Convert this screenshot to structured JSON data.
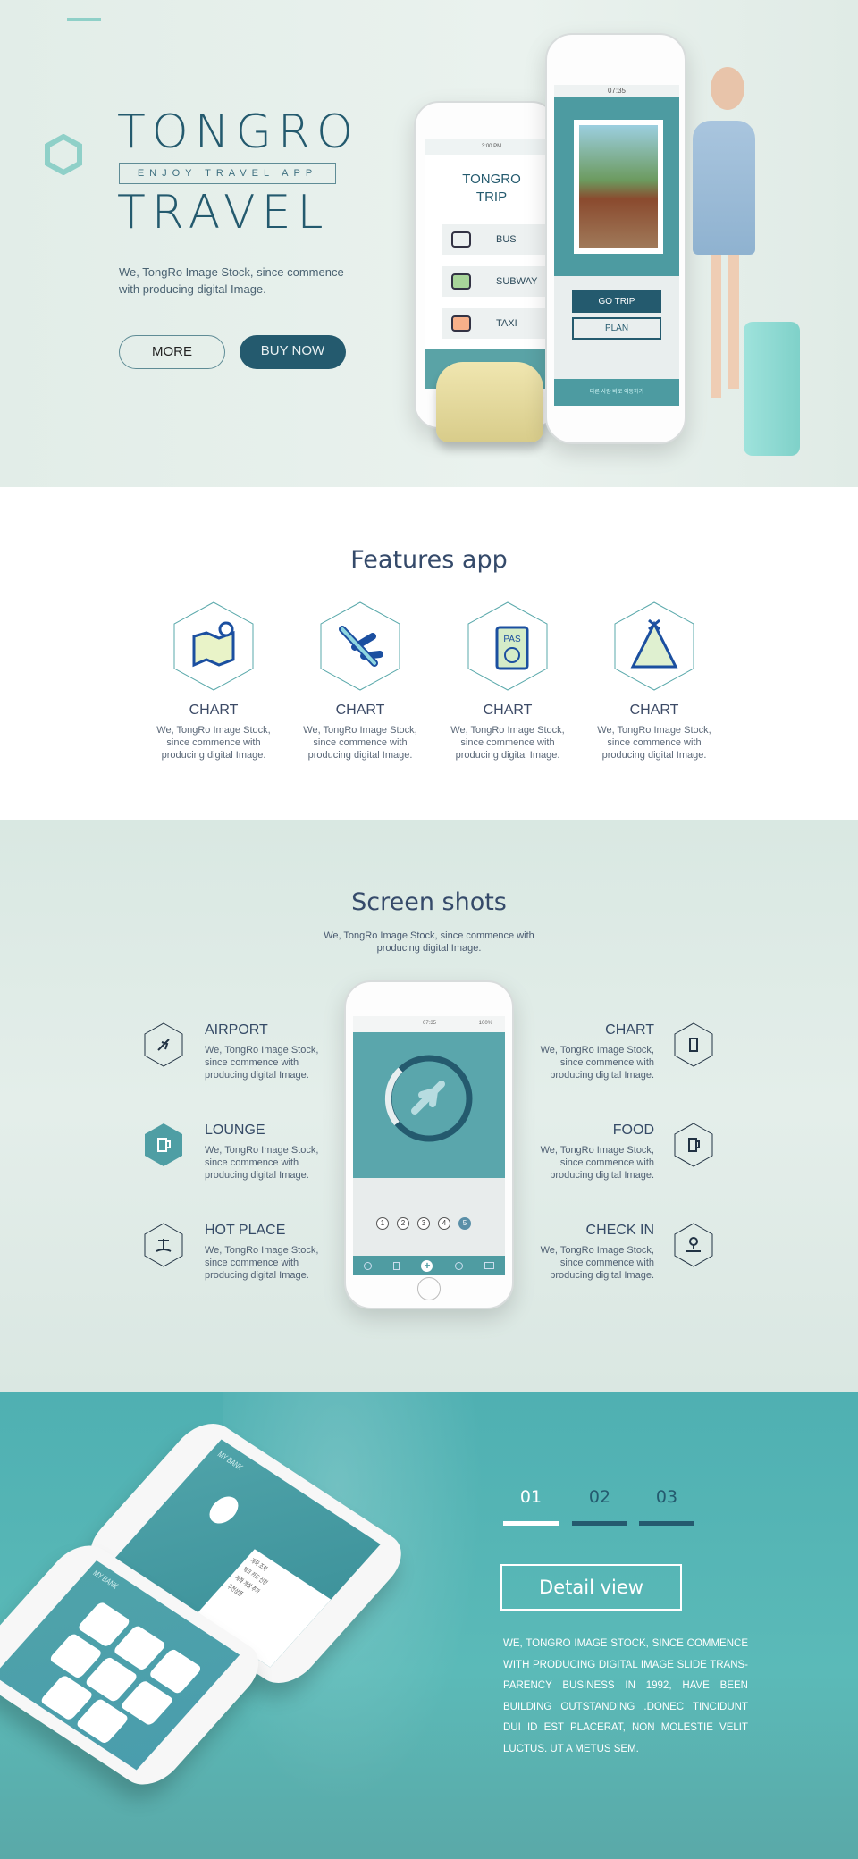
{
  "hero": {
    "title_top": "TONGRO",
    "tagline": "ENJOY TRAVEL APP",
    "title_bottom": "TRAVEL",
    "description": "We, TongRo Image Stock, since commence with producing digital Image.",
    "more_label": "MORE",
    "buy_label": "BUY NOW",
    "phone_left": {
      "status_time": "3:00 PM",
      "app_title_1": "TONGRO",
      "app_title_2": "TRIP",
      "options": [
        {
          "label": "BUS",
          "icon": "bus-icon"
        },
        {
          "label": "SUBWAY",
          "icon": "subway-icon"
        },
        {
          "label": "TAXI",
          "icon": "taxi-icon"
        }
      ]
    },
    "phone_right": {
      "status_time": "07:35",
      "go_trip": "GO TRIP",
      "plan": "PLAN",
      "footer_text": "다른 사람 바로 이동하기"
    }
  },
  "features": {
    "title": "Features app",
    "items": [
      {
        "title": "CHART",
        "description": "We, TongRo Image Stock, since commence with producing digital Image.",
        "icon": "map-icon"
      },
      {
        "title": "CHART",
        "description": "We, TongRo Image Stock, since commence with producing digital Image.",
        "icon": "airplane-icon"
      },
      {
        "title": "CHART",
        "description": "We, TongRo Image Stock, since commence with producing digital Image.",
        "icon": "passport-icon",
        "icon_text": "PAS"
      },
      {
        "title": "CHART",
        "description": "We, TongRo Image Stock, since commence with producing digital Image.",
        "icon": "tent-icon"
      }
    ]
  },
  "screenshots": {
    "title": "Screen shots",
    "subtitle": "We, TongRo Image Stock, since commence with producing digital Image.",
    "left": [
      {
        "title": "AIRPORT",
        "description": "We, TongRo Image Stock, since commence with producing digital Image.",
        "icon": "airplane-icon"
      },
      {
        "title": "LOUNGE",
        "description": "We, TongRo Image Stock, since commence with producing digital Image.",
        "icon": "beer-icon",
        "active": true
      },
      {
        "title": "HOT PLACE",
        "description": "We, TongRo Image Stock, since commence with producing digital Image.",
        "icon": "palm-island-icon"
      }
    ],
    "right": [
      {
        "title": "CHART",
        "description": "We, TongRo Image Stock, since commence with producing digital Image.",
        "icon": "luggage-icon"
      },
      {
        "title": "FOOD",
        "description": "We, TongRo Image Stock, since commence with producing digital Image.",
        "icon": "beer-icon"
      },
      {
        "title": "CHECK IN",
        "description": "We, TongRo Image Stock, since commence with producing digital Image.",
        "icon": "location-pin-icon"
      }
    ],
    "phone": {
      "status_time": "07:35",
      "battery": "100%",
      "steps": [
        "1",
        "2",
        "3",
        "4",
        "5"
      ],
      "active_step": 5
    }
  },
  "detail": {
    "tabs": [
      "01",
      "02",
      "03"
    ],
    "active_tab": 0,
    "button_label": "Detail view",
    "paragraph": "We, TongRo Image Stock, since commence with producing digital Image slide trans-parency business in 1992, have been building outstanding .Donec tincidunt dui id est placerat, non molestie velit luctus. Ut a metus sem.",
    "phone_title": "MY BANK",
    "phone_title_2": "MY BANK",
    "menu": [
      "계좌 조회",
      "체크 카드 신청",
      "계좌 개설 추가",
      "추천상품"
    ]
  },
  "colors": {
    "primary": "#245a6e",
    "teal": "#5aa9ab",
    "bg_light": "#e2ede8",
    "detail_bg": "#55b3b4"
  }
}
